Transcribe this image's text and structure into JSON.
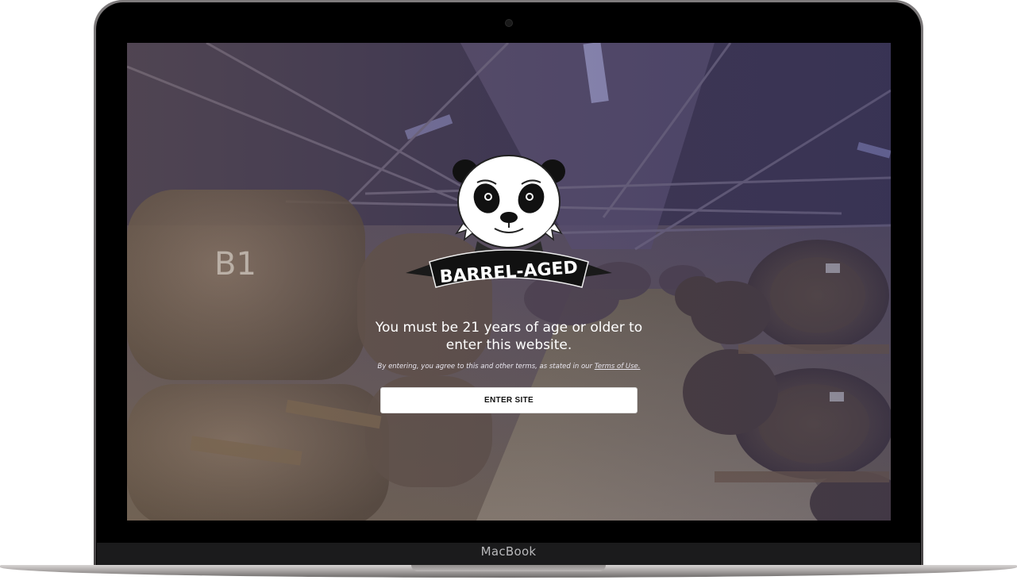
{
  "device": {
    "brand_label": "MacBook"
  },
  "age_gate": {
    "logo_text": "BARREL-AGED",
    "headline_line1": "You must be 21 years of age or older to",
    "headline_line2": "enter this website.",
    "terms_prefix": "By entering, you agree to this and other terms, as stated in our",
    "terms_link": "Terms of Use.",
    "enter_button": "ENTER SITE"
  },
  "background": {
    "barrel_marking": "B1"
  },
  "colors": {
    "overlay": "#4b4359",
    "button_bg": "#ffffff",
    "text": "#ffffff"
  }
}
